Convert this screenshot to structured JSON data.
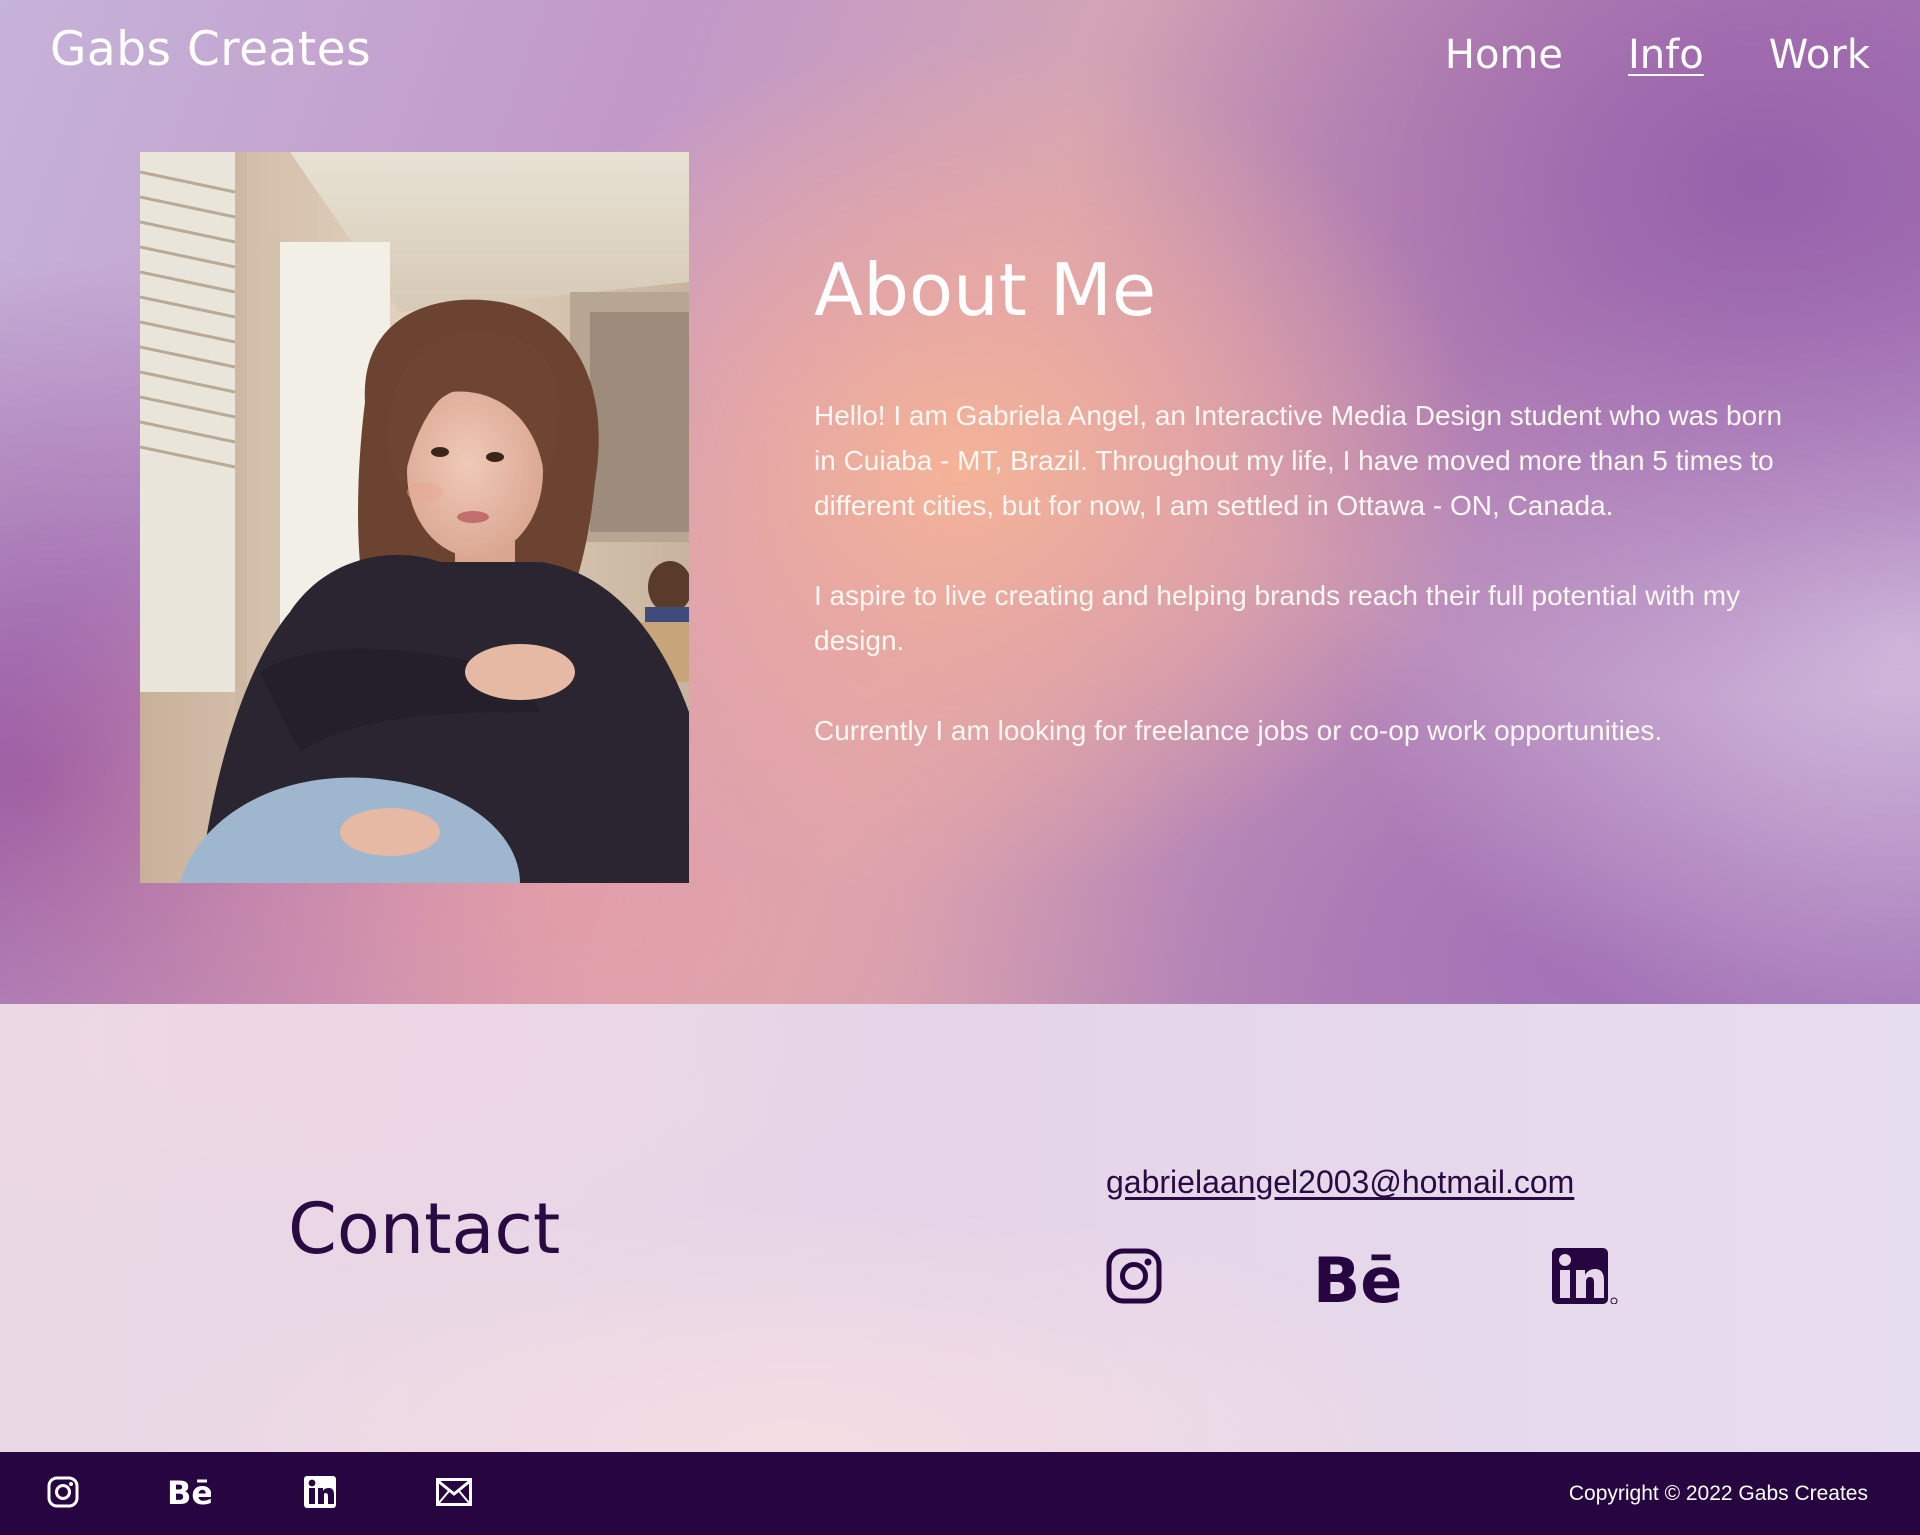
{
  "header": {
    "brand": "Gabs Creates",
    "nav": [
      {
        "label": "Home",
        "active": false
      },
      {
        "label": "Info",
        "active": true
      },
      {
        "label": "Work",
        "active": false
      }
    ]
  },
  "about": {
    "title": "About Me",
    "paragraphs": [
      "Hello! I am Gabriela Angel, an Interactive Media Design student who was born in Cuiaba - MT, Brazil. Throughout my life, I have moved more than 5 times to different cities, but for now, I am settled in Ottawa - ON, Canada.",
      "I aspire to live creating and helping brands reach their full potential with my design.",
      "Currently I am looking for freelance jobs or co-op work opportunities."
    ]
  },
  "contact": {
    "title": "Contact",
    "email": "gabrielaangel2003@hotmail.com",
    "socials": [
      "instagram-icon",
      "behance-icon",
      "linkedin-icon"
    ]
  },
  "footer": {
    "icons": [
      "instagram-icon",
      "behance-icon",
      "linkedin-icon",
      "mail-icon"
    ],
    "copyright": "Copyright © 2022 Gabs Creates"
  },
  "colors": {
    "dark_purple": "#260541",
    "contact_text": "#2a0a42",
    "white": "#ffffff"
  }
}
